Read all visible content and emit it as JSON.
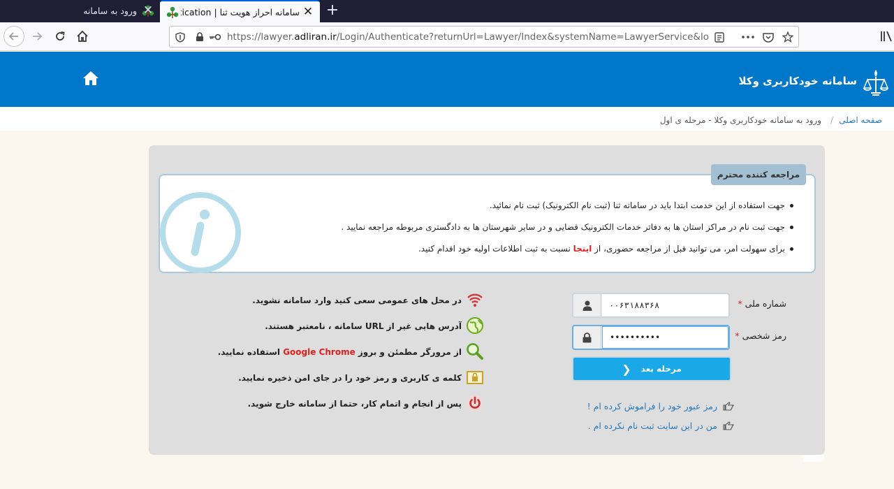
{
  "browser": {
    "tabs": [
      {
        "title": "ورود به سامانه",
        "active": false
      },
      {
        "title": "سامانه احراز هویت ثنا | Authentication",
        "active": true
      }
    ],
    "url_prefix": "https://lawyer.",
    "url_domain": "adliran.ir",
    "url_rest": "/Login/Authenticate?returnUrl=Lawyer/Index&systemName=LawyerService&loginType=",
    "colors": {
      "tabbar": "#1f1e36",
      "accent": "#0060df"
    }
  },
  "header": {
    "title": "سامانه خودکاربری وکلا",
    "color": "#0077c8"
  },
  "breadcrumb": {
    "home": "صفحه اصلی",
    "separator": "/",
    "current": "ورود به سامانه خودکاربری وکلا - مرحله ی اول"
  },
  "notice": {
    "title": "مراجعه کننده محترم",
    "items": [
      "جهت استفاده از این خدمت ابتدا باید در سامانه ثنا (ثبت نام الکترونیک) ثبت نام نمائید.",
      "جهت ثبت نام در مراکز استان ها به دفاتر خدمات الکترونیک قضایی و در سایر شهرستان ها به دادگستری مربوطه مراجعه نمایید ."
    ],
    "item3_before": "برای سهولت امر، می توانید قبل از مراجعه حضوری، از ",
    "item3_link": "اینجا",
    "item3_after": " نسبت به ثبت اطلاعات اولیه خود اقدام کنید."
  },
  "tips": [
    {
      "icon": "wifi-icon",
      "text": "در محل های عمومی سعی کنید وارد سامانه نشوید."
    },
    {
      "icon": "globe-icon",
      "text": "آدرس هایی غیر از URL سامانه ، نامعتبر هستند."
    },
    {
      "icon": "magnifier-icon",
      "before": "از مرورگر مطمئن و بروز ",
      "highlight": "Google Chrome",
      "after": " استفاده نمایید."
    },
    {
      "icon": "lock-box-icon",
      "text": "کلمه ی کاربری و رمز خود را در جای امن ذخیره نمایید."
    },
    {
      "icon": "power-icon",
      "text": "پس از انجام و اتمام کار، حتما از سامانه خارج شوید."
    }
  ],
  "form": {
    "national_id_label": "شماره ملی",
    "national_id_value": "۰۰۶۳۱۸۸۳۶۸",
    "password_label": "رمز شخصی",
    "password_value": "••••••••••",
    "required_mark": "*",
    "next_button": "مرحله بعد",
    "forgot_link": "رمز عبور خود را فراموش کرده ام !",
    "register_link": "من در این سایت ثبت نام نکرده ام ."
  }
}
